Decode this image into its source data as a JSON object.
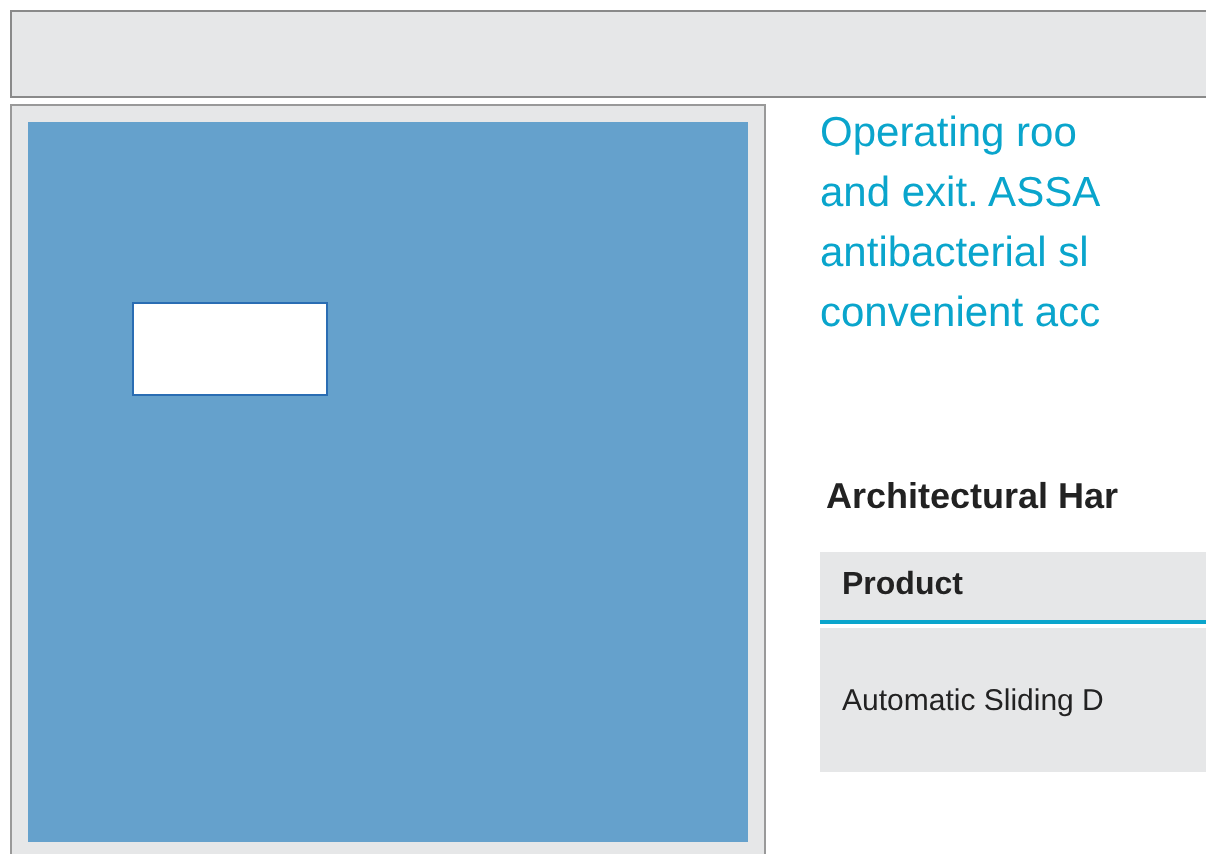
{
  "intro_lines": [
    "Operating roo",
    "and exit. ASSA",
    "antibacterial sl",
    "convenient acc"
  ],
  "section_title": "Architectural Har",
  "table": {
    "columns": [
      "Product"
    ],
    "rows": [
      [
        "Automatic Sliding D"
      ]
    ]
  }
}
